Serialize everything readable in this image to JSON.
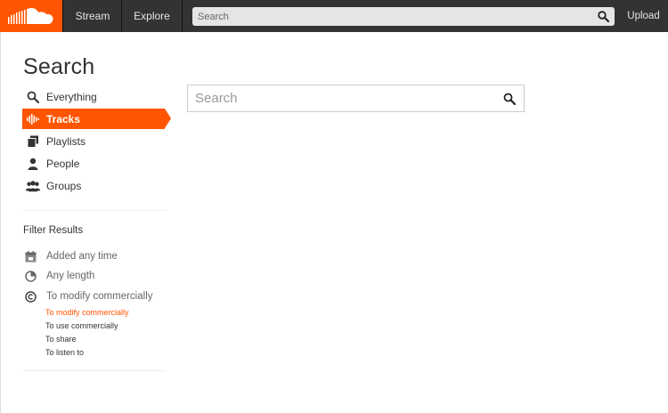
{
  "header": {
    "nav": [
      {
        "label": "Stream"
      },
      {
        "label": "Explore"
      }
    ],
    "search_placeholder": "Search",
    "upload_label": "Upload"
  },
  "colors": {
    "accent": "#ff5500",
    "header_bg": "#333333"
  },
  "page_title": "Search",
  "sidebar": {
    "items": [
      {
        "label": "Everything",
        "icon": "search-icon"
      },
      {
        "label": "Tracks",
        "icon": "waveform-icon",
        "active": true
      },
      {
        "label": "Playlists",
        "icon": "playlist-icon"
      },
      {
        "label": "People",
        "icon": "person-icon"
      },
      {
        "label": "Groups",
        "icon": "group-icon"
      }
    ]
  },
  "filters": {
    "title": "Filter Results",
    "rows": [
      {
        "label": "Added any time",
        "icon": "calendar-icon"
      },
      {
        "label": "Any length",
        "icon": "clock-icon"
      },
      {
        "label": "To modify commercially",
        "icon": "copyright-icon"
      }
    ],
    "license_options": [
      {
        "label": "To modify commercially",
        "selected": true
      },
      {
        "label": "To use commercially"
      },
      {
        "label": "To share"
      },
      {
        "label": "To listen to"
      }
    ]
  },
  "main": {
    "search_placeholder": "Search"
  }
}
